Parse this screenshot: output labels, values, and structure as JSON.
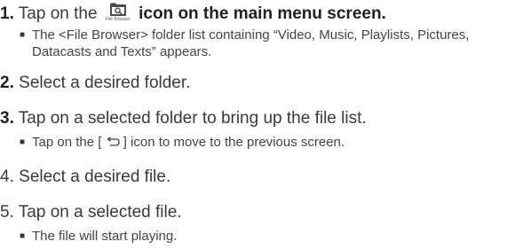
{
  "steps": [
    {
      "number": "1.",
      "prefix": "Tap on the",
      "icon_name": "file-browser-icon",
      "icon_caption": "File Browser",
      "suffix": "icon on the main menu screen.",
      "note": "The <File Browser> folder list containing “Video, Music, Playlists, Pictures, Datacasts and Texts” appears."
    },
    {
      "number": "2.",
      "text": "Select a desired folder."
    },
    {
      "number": "3.",
      "text": "Tap on a selected folder to bring up the file list.",
      "note_prefix": "Tap on the [",
      "note_icon_name": "back-arrow-icon",
      "note_suffix": "] icon to move to the previous screen."
    },
    {
      "number": "4.",
      "text": "Select a desired file."
    },
    {
      "number": "5.",
      "text": "Tap on a selected file.",
      "note": "The file will start playing."
    }
  ]
}
